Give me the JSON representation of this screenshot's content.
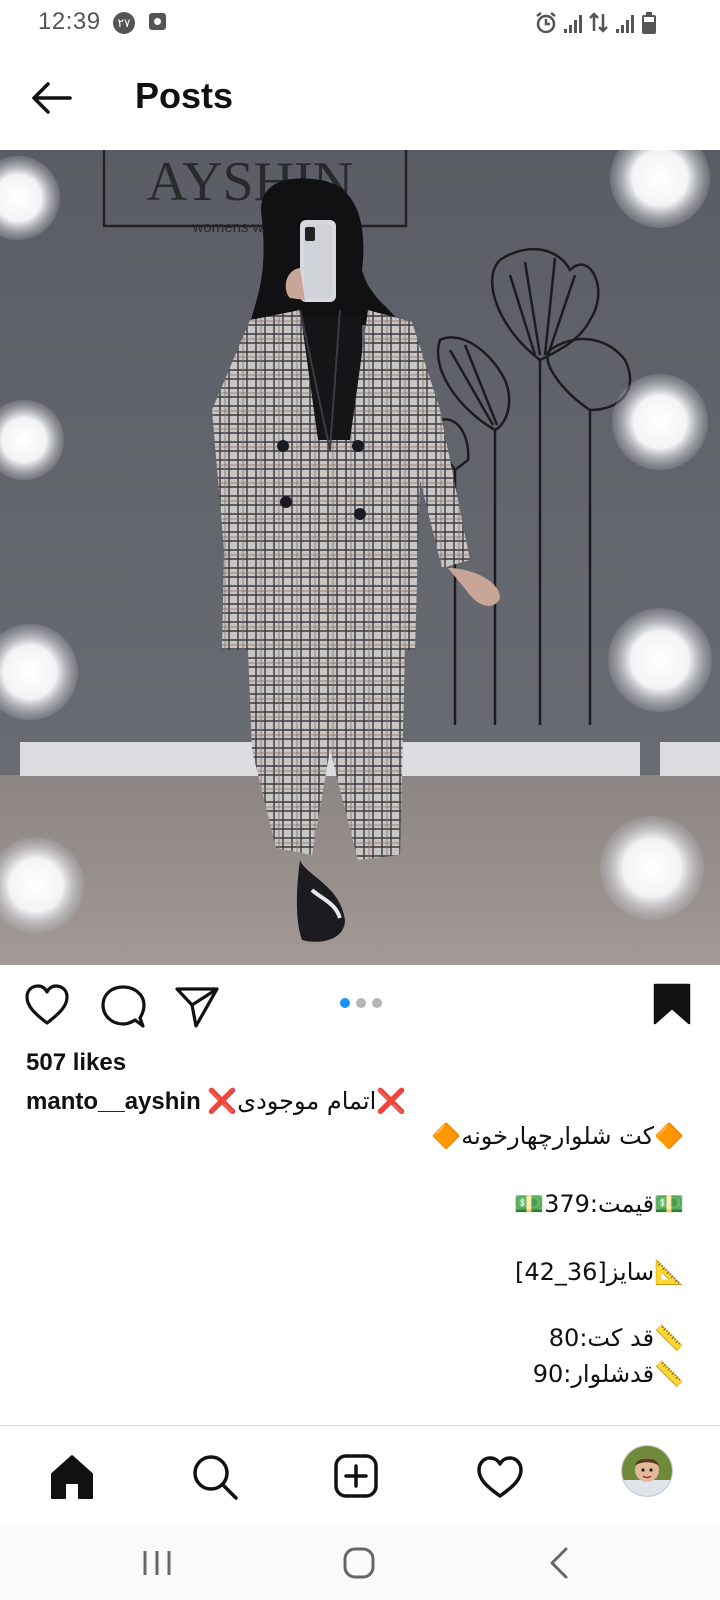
{
  "status_bar": {
    "time": "12:39",
    "date_badge": "۲۷",
    "icons": [
      "alarm-icon",
      "signal-icon",
      "data-arrows-icon",
      "signal-icon",
      "battery-icon"
    ]
  },
  "header": {
    "title": "Posts",
    "back_icon": "arrow-left-icon"
  },
  "post": {
    "image_text": {
      "brand": "AYSHIN",
      "brand_sub": "womens w"
    },
    "actions": [
      "heart-icon",
      "comment-icon",
      "share-icon",
      "bookmark-icon"
    ],
    "carousel": {
      "count": 3,
      "active": 0,
      "active_color": "#1e90ff"
    },
    "likes": "507 likes",
    "username": "manto__ayshin",
    "caption_lines": [
      "❌اتمام موجودی❌",
      "🔶کت شلوارچهارخونه🔶",
      "💵قیمت:379💵",
      "📐سایز[36_42]",
      "📏قد کت:80",
      "📏قدشلوار:90"
    ]
  },
  "bottom_nav": [
    "home-icon",
    "search-icon",
    "add-post-icon",
    "activity-heart-icon",
    "profile-avatar"
  ],
  "system_nav": [
    "recents-icon",
    "home-circle-icon",
    "back-chevron-icon"
  ],
  "colors": {
    "accent": "#1e90ff",
    "text": "#111111",
    "divider": "#dcdcdc"
  }
}
